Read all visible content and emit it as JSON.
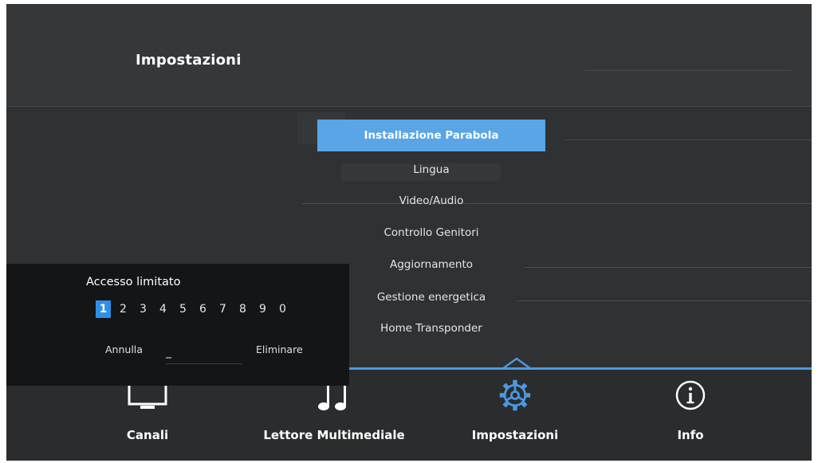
{
  "header": {
    "title": "Impostazioni"
  },
  "menu": {
    "items": [
      {
        "label": "Installazione Parabola",
        "selected": true
      },
      {
        "label": "Lingua"
      },
      {
        "label": "Video/Audio"
      },
      {
        "label": "Controllo Genitori"
      },
      {
        "label": "Aggiornamento"
      },
      {
        "label": "Gestione energetica"
      },
      {
        "label": "Home Transponder"
      }
    ]
  },
  "nav": {
    "items": [
      {
        "label": "Canali",
        "icon": "tv-icon"
      },
      {
        "label": "Lettore Multimediale",
        "icon": "music-note-icon"
      },
      {
        "label": "Impostazioni",
        "icon": "gear-icon",
        "active": true
      },
      {
        "label": "Info",
        "icon": "info-icon"
      }
    ]
  },
  "dialog": {
    "title": "Accesso limitato",
    "digits": [
      "1",
      "2",
      "3",
      "4",
      "5",
      "6",
      "7",
      "8",
      "9",
      "0"
    ],
    "selected_digit": "1",
    "pin_value": "_",
    "cancel_label": "Annulla",
    "delete_label": "Eliminare"
  },
  "colors": {
    "accent": "#4d98e0",
    "selection": "#5aa5e6",
    "background": "#2f3132"
  }
}
